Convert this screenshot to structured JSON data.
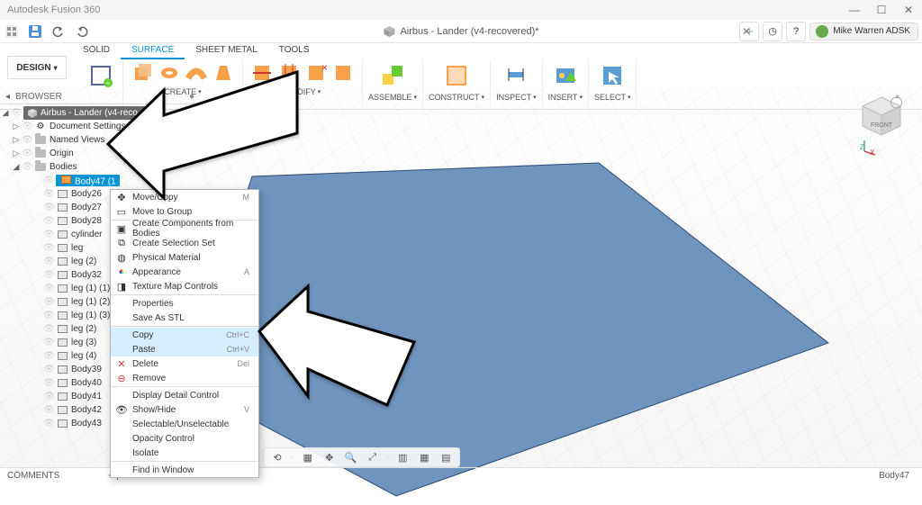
{
  "app": {
    "title": "Autodesk Fusion 360"
  },
  "window_buttons": {
    "min": "—",
    "max": "☐",
    "close": "✕"
  },
  "document": {
    "name": "Airbus - Lander (v4-recovered)*",
    "close": "✕"
  },
  "user": {
    "name": "Mike Warren ADSK"
  },
  "tabs": {
    "items": [
      "SOLID",
      "SURFACE",
      "SHEET METAL",
      "TOOLS"
    ],
    "active": "SURFACE"
  },
  "design_button": "DESIGN",
  "ribbon_groups": {
    "create": "CREATE",
    "modify": "MODIFY",
    "assemble": "ASSEMBLE",
    "construct": "CONSTRUCT",
    "inspect": "INSPECT",
    "insert": "INSERT",
    "select": "SELECT"
  },
  "browser": {
    "title": "BROWSER",
    "root": {
      "label": "Airbus - Lander (v4-reco",
      "version_badge": ""
    },
    "top_nodes": [
      {
        "label": "Document Settings",
        "icon": "gear"
      },
      {
        "label": "Named Views",
        "icon": "folder"
      },
      {
        "label": "Origin",
        "icon": "folder"
      },
      {
        "label": "Bodies",
        "icon": "folder",
        "expanded": true
      }
    ],
    "bodies": [
      {
        "label": "Body47 (1",
        "selected": true,
        "icon": "surface-orange"
      },
      {
        "label": "Body26",
        "icon": "surface"
      },
      {
        "label": "Body27",
        "icon": "surface"
      },
      {
        "label": "Body28",
        "icon": "surface"
      },
      {
        "label": "cylinder",
        "icon": "surface"
      },
      {
        "label": "leg",
        "icon": "surface"
      },
      {
        "label": "leg (2)",
        "icon": "surface"
      },
      {
        "label": "Body32",
        "icon": "surface"
      },
      {
        "label": "leg (1) (1)",
        "icon": "surface"
      },
      {
        "label": "leg (1) (2)",
        "icon": "surface"
      },
      {
        "label": "leg (1) (3)",
        "icon": "surface"
      },
      {
        "label": "leg (2)",
        "icon": "surface"
      },
      {
        "label": "leg (3)",
        "icon": "surface"
      },
      {
        "label": "leg (4)",
        "icon": "surface"
      },
      {
        "label": "Body39",
        "icon": "surface"
      },
      {
        "label": "Body40",
        "icon": "surface"
      },
      {
        "label": "Body41",
        "icon": "surface"
      },
      {
        "label": "Body42",
        "icon": "surface"
      },
      {
        "label": "Body43",
        "icon": "surface"
      }
    ]
  },
  "context_menu": {
    "items": [
      {
        "label": "Move/Copy",
        "shortcut": "M",
        "icon": "✥"
      },
      {
        "label": "Move to Group",
        "icon": "▭"
      },
      {
        "sep": true
      },
      {
        "label": "Create Components from Bodies",
        "icon": "▣"
      },
      {
        "label": "Create Selection Set",
        "icon": "⧉"
      },
      {
        "label": "Physical Material",
        "icon": "◍"
      },
      {
        "label": "Appearance",
        "shortcut": "A",
        "icon": "●"
      },
      {
        "label": "Texture Map Controls",
        "icon": "◨"
      },
      {
        "sep": true
      },
      {
        "label": "Properties"
      },
      {
        "label": "Save As STL"
      },
      {
        "sep": true
      },
      {
        "label": "Copy",
        "shortcut": "Ctrl+C",
        "hl": true
      },
      {
        "label": "Paste",
        "shortcut": "Ctrl+V",
        "hl": true
      },
      {
        "label": "Delete",
        "shortcut": "Del",
        "icon": "✕",
        "iconColor": "#d33"
      },
      {
        "label": "Remove",
        "icon": "⊖",
        "iconColor": "#d33"
      },
      {
        "sep": true
      },
      {
        "label": "Display Detail Control"
      },
      {
        "label": "Show/Hide",
        "shortcut": "V",
        "icon": "👁"
      },
      {
        "label": "Selectable/Unselectable"
      },
      {
        "label": "Opacity Control"
      },
      {
        "label": "Isolate"
      },
      {
        "sep": true
      },
      {
        "label": "Find in Window"
      }
    ]
  },
  "statusbar": {
    "comments": "COMMENTS",
    "selection": "Body47"
  },
  "viewcube": {
    "face": "FRONT"
  }
}
